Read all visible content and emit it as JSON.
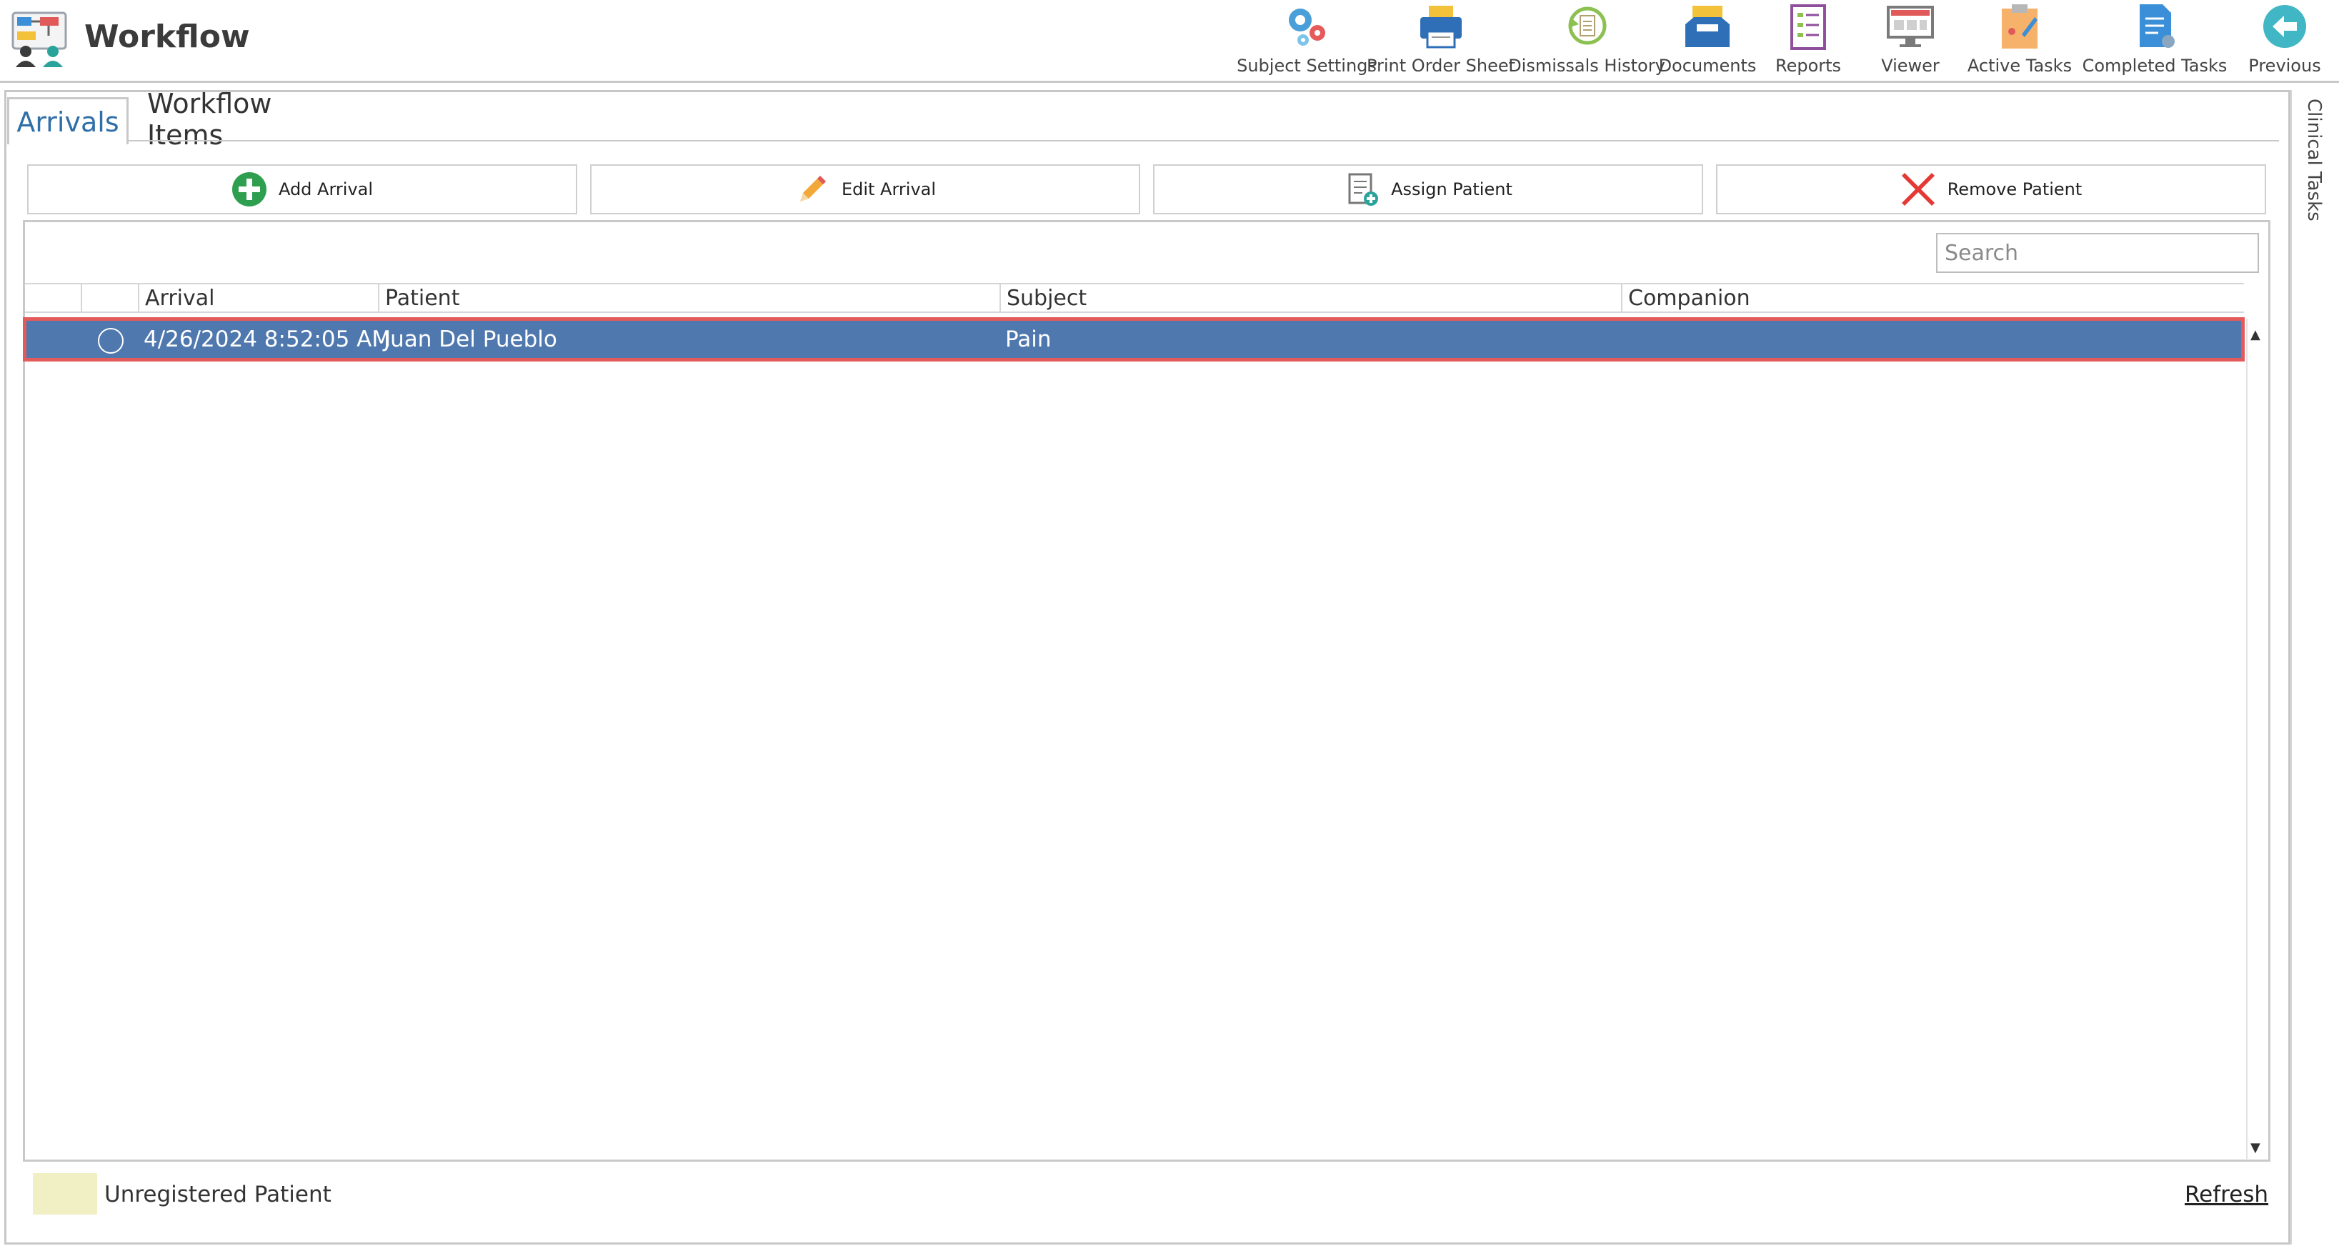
{
  "app": {
    "title": "Workflow"
  },
  "toolbar": {
    "items": [
      {
        "label": "Subject Settings",
        "icon": "gears-icon"
      },
      {
        "label": "Print Order Sheet",
        "icon": "printer-icon"
      },
      {
        "label": "Dismissals History",
        "icon": "history-icon"
      },
      {
        "label": "Documents",
        "icon": "inbox-tray-icon"
      },
      {
        "label": "Reports",
        "icon": "report-icon"
      },
      {
        "label": "Viewer",
        "icon": "monitor-icon"
      },
      {
        "label": "Active Tasks",
        "icon": "clipboard-icon"
      },
      {
        "label": "Completed Tasks",
        "icon": "document-check-icon"
      },
      {
        "label": "Previous",
        "icon": "back-arrow-icon"
      }
    ]
  },
  "side_panel": {
    "label": "Clinical Tasks"
  },
  "tabs": [
    {
      "label": "Arrivals",
      "active": true
    },
    {
      "label": "Workflow Items",
      "active": false
    }
  ],
  "actions": {
    "add": "Add Arrival",
    "edit": "Edit Arrival",
    "assign": "Assign Patient",
    "remove": "Remove Patient"
  },
  "search": {
    "placeholder": "Search",
    "value": ""
  },
  "table": {
    "columns": [
      "Arrival",
      "Patient",
      "Subject",
      "Companion"
    ],
    "rows": [
      {
        "arrival": "4/26/2024 8:52:05 AM",
        "patient": "Juan Del Pueblo",
        "subject": "Pain",
        "companion": "",
        "selected": true
      }
    ]
  },
  "legend": {
    "unregistered": "Unregistered Patient",
    "swatch_color": "#f1f0c4"
  },
  "footer": {
    "refresh": "Refresh"
  },
  "colors": {
    "accent": "#2f6fa8",
    "row_selected": "#4f78ae",
    "row_highlight_border": "#e35a5a"
  }
}
